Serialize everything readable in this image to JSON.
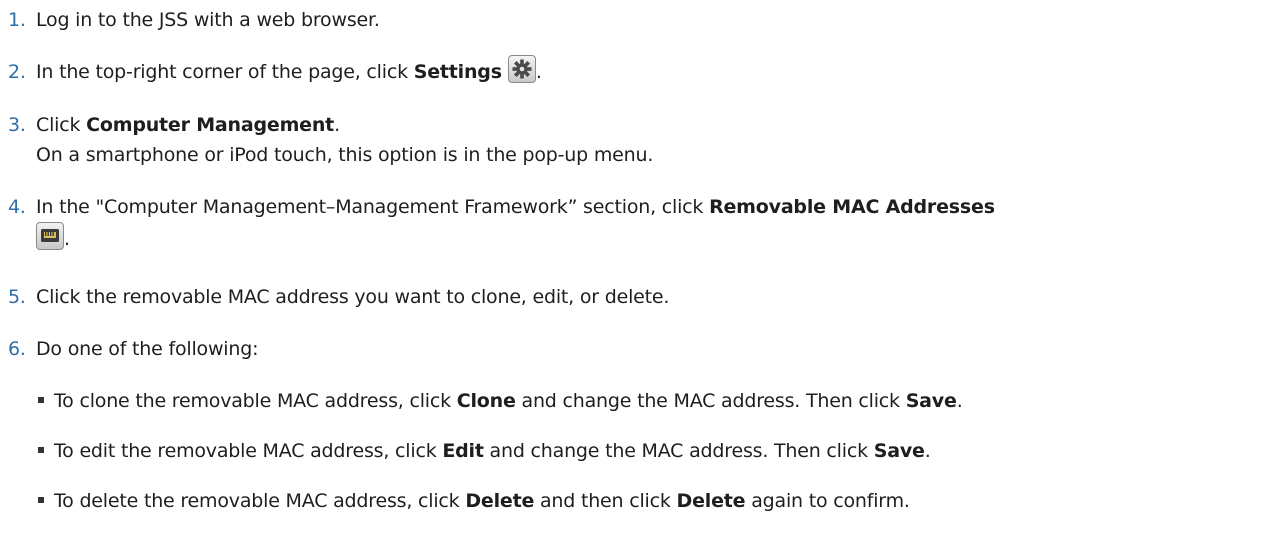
{
  "steps": [
    {
      "num": "1.",
      "text": "Log in to the JSS with a web browser."
    },
    {
      "num": "2.",
      "pre": "In the top-right corner of the page, click ",
      "bold": "Settings",
      "post": "."
    },
    {
      "num": "3.",
      "pre": "Click ",
      "bold": "Computer Management",
      "post": ".",
      "line2": "On a smartphone or iPod touch, this option is in the pop-up menu."
    },
    {
      "num": "4.",
      "pre": "In the \"Computer Management–Management Framework” section, click ",
      "bold": "Removable MAC Addresses",
      "post": "."
    },
    {
      "num": "5.",
      "text": "Click the removable MAC address you want to clone, edit, or delete."
    },
    {
      "num": "6.",
      "text": "Do one of the following:"
    }
  ],
  "bullets": [
    {
      "t1": "To clone the removable MAC address, click ",
      "b1": "Clone",
      "t2": " and change the MAC address. Then click ",
      "b2": "Save",
      "t3": "."
    },
    {
      "t1": "To edit the removable MAC address, click ",
      "b1": "Edit",
      "t2": " and change the MAC address. Then click ",
      "b2": "Save",
      "t3": "."
    },
    {
      "t1": "To delete the removable MAC address, click ",
      "b1": "Delete",
      "t2": " and then click ",
      "b2": "Delete",
      "t3": " again to confirm."
    }
  ],
  "icons": {
    "settings": "gear-icon",
    "removable_mac": "network-port-icon"
  }
}
